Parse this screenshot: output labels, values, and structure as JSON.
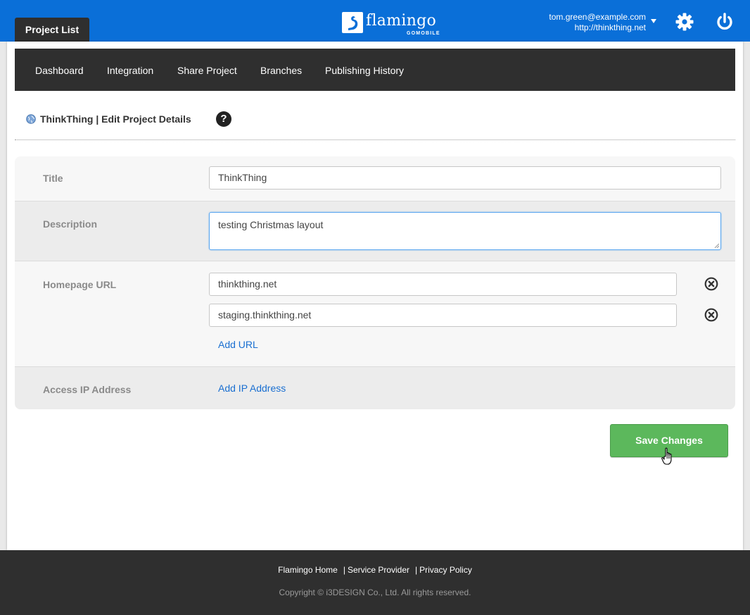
{
  "header": {
    "tab_project_list": "Project List",
    "logo_word": "flamingo",
    "logo_sub": "GOMOBILE",
    "account_email": "tom.green@example.com",
    "account_site": "http://thinkthing.net"
  },
  "subnav": {
    "items": [
      "Dashboard",
      "Integration",
      "Share Project",
      "Branches",
      "Publishing History"
    ]
  },
  "page": {
    "title": "ThinkThing | Edit Project Details",
    "help_glyph": "?"
  },
  "form": {
    "title_label": "Title",
    "title_value": "ThinkThing",
    "description_label": "Description",
    "description_value": "testing Christmas layout",
    "homepage_label": "Homepage URL",
    "urls": [
      "thinkthing.net",
      "staging.thinkthing.net"
    ],
    "add_url": "Add URL",
    "access_ip_label": "Access IP Address",
    "add_ip": "Add IP Address"
  },
  "actions": {
    "save_label": "Save Changes"
  },
  "footer": {
    "links": [
      "Flamingo Home",
      "Service Provider",
      "Privacy Policy"
    ],
    "copyright": "Copyright © i3DESIGN Co., Ltd. All rights reserved."
  },
  "colors": {
    "topbar": "#0a6fd8",
    "dark_bar": "#2f2f2f",
    "save_green": "#5cb85c",
    "link_blue": "#1a6fd1"
  },
  "icons": [
    "gear-icon",
    "power-icon",
    "globe-icon",
    "help-icon",
    "remove-circle-icon",
    "hand-cursor-icon"
  ]
}
